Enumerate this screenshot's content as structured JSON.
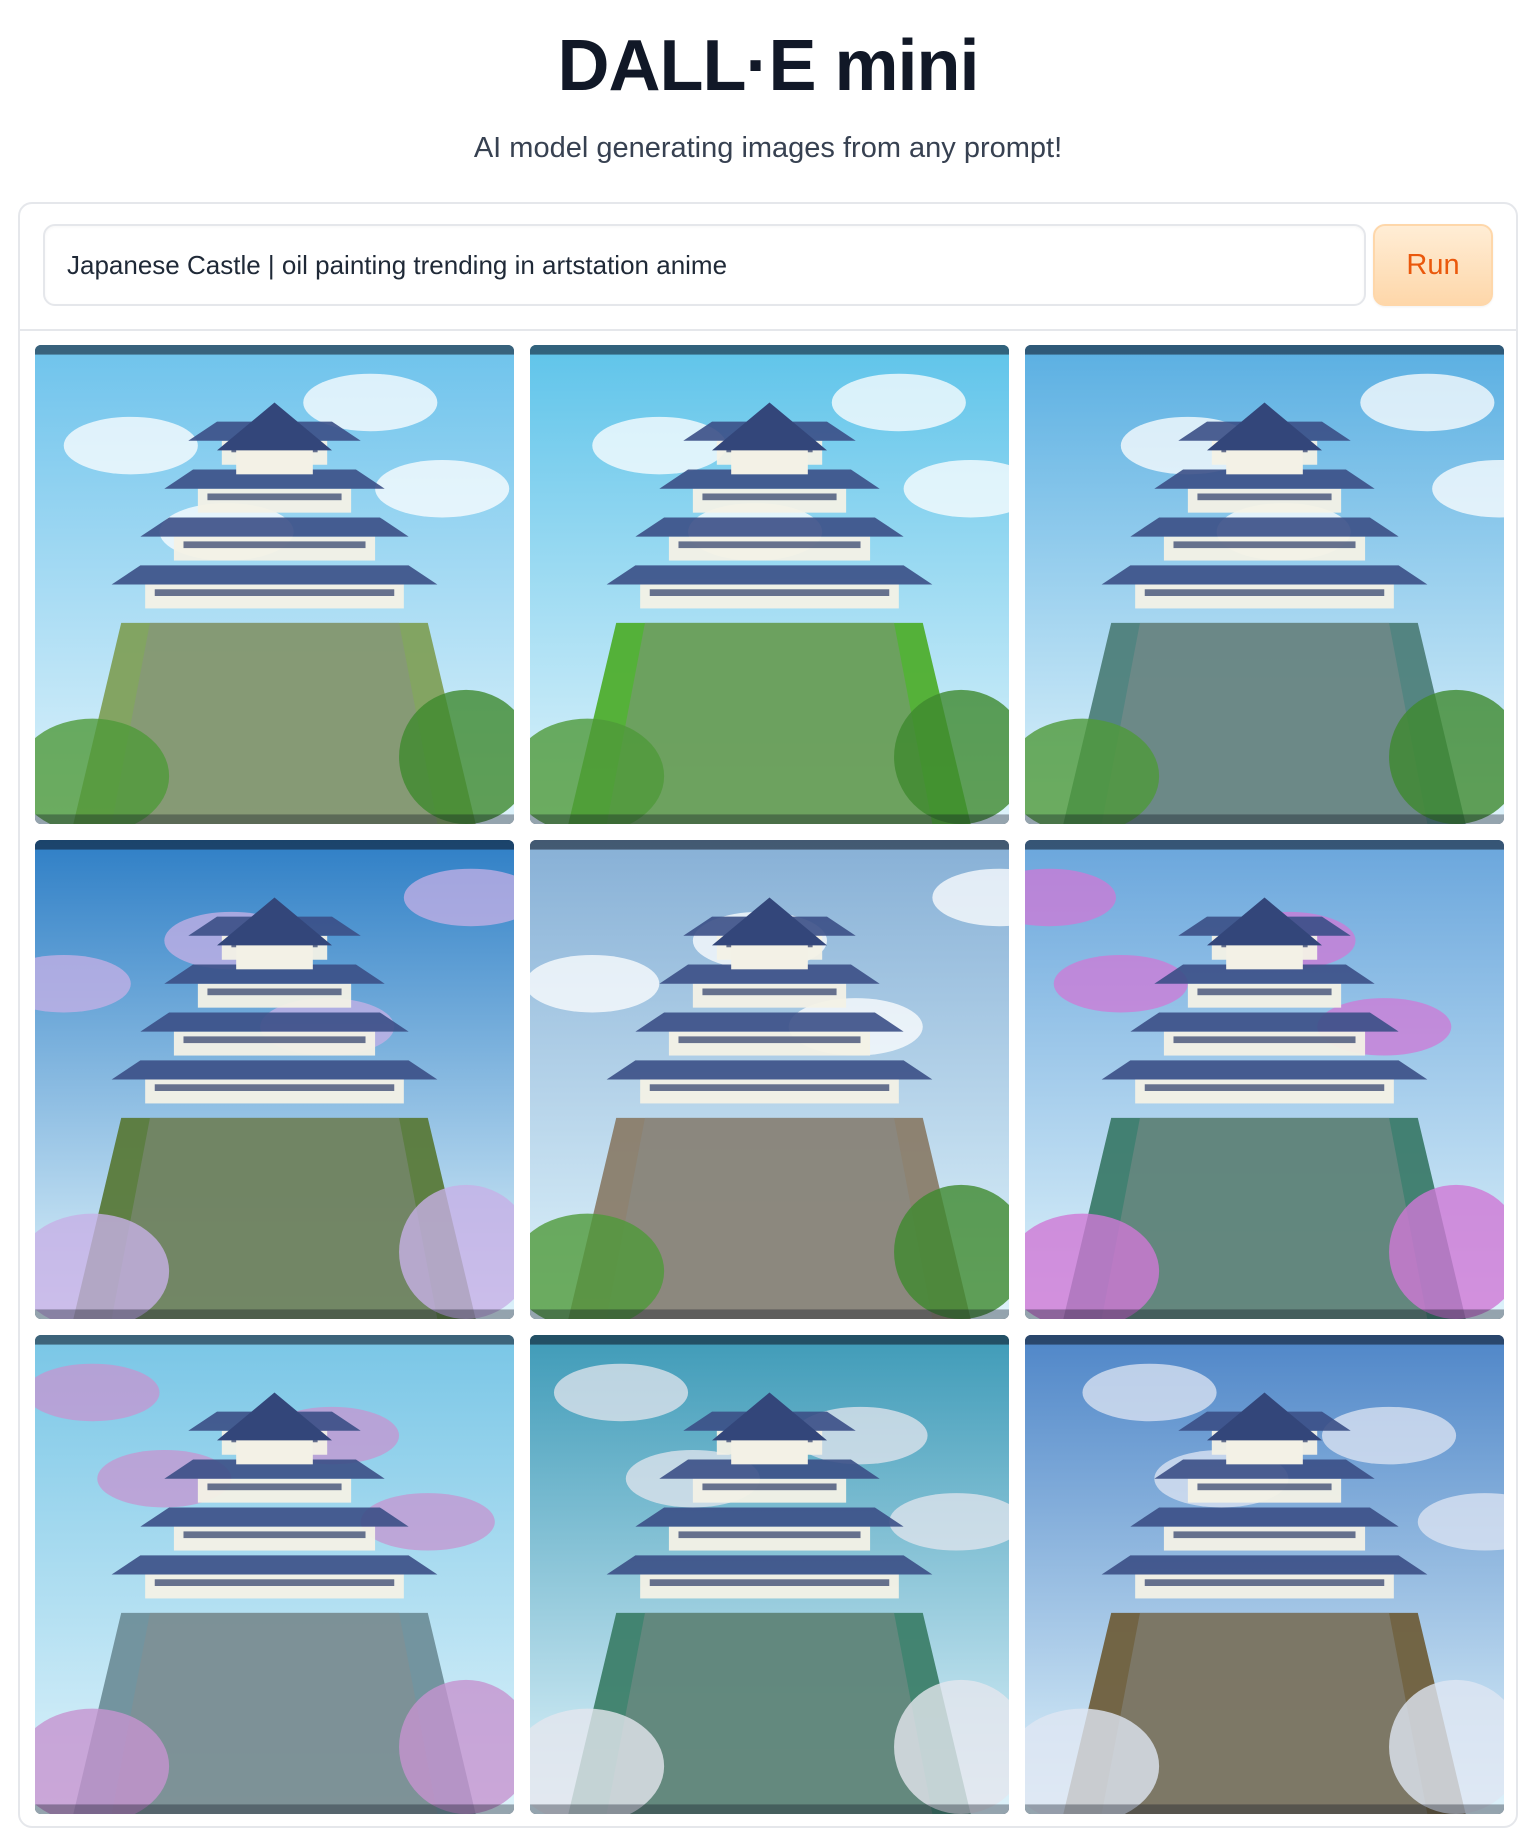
{
  "app": {
    "title": "DALL·E mini",
    "subtitle": "AI model generating images from any prompt!"
  },
  "prompt": {
    "value": "Japanese Castle | oil painting trending in artstation anime",
    "placeholder": ""
  },
  "toolbar": {
    "run_label": "Run"
  },
  "colors": {
    "accent": "#ea580c",
    "run_bg": "#fed7aa",
    "border": "#e5e7eb"
  },
  "gallery": {
    "images": [
      {
        "sky": "#6ec3ec",
        "ground": "#7fa05a",
        "accent": "#ffffff"
      },
      {
        "sky": "#5fc4ea",
        "ground": "#4fae2e",
        "accent": "#ffffff"
      },
      {
        "sky": "#5aafe2",
        "ground": "#4e7f7a",
        "accent": "#ffffff"
      },
      {
        "sky": "#2f7fc6",
        "ground": "#5a7a3a",
        "accent": "#c7b0e6"
      },
      {
        "sky": "#87b0d6",
        "ground": "#8a7d6a",
        "accent": "#ffffff"
      },
      {
        "sky": "#6aa6dc",
        "ground": "#3c7b6a",
        "accent": "#cf78d6"
      },
      {
        "sky": "#79c6e6",
        "ground": "#6f8f9a",
        "accent": "#c694d0"
      },
      {
        "sky": "#3f9bb8",
        "ground": "#3d7f6a",
        "accent": "#e3e6ee"
      },
      {
        "sky": "#4f86c8",
        "ground": "#6f5f3c",
        "accent": "#dfe6f3"
      }
    ]
  }
}
